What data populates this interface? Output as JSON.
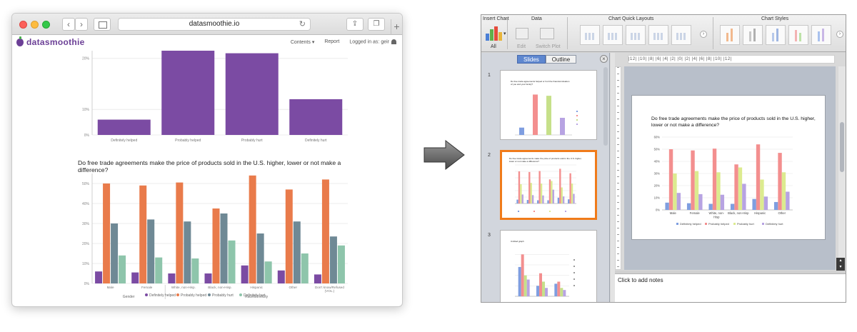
{
  "browser": {
    "url": "datasmoothie.io",
    "site_name": "datasmoothie",
    "nav": {
      "contents": "Contents",
      "report": "Report",
      "logged_in": "Logged in as: geir"
    },
    "top_chart": {
      "categories": [
        "Definitely helped",
        "Probably helped",
        "Probably hurt",
        "Definitely hurt"
      ],
      "values": [
        6,
        33,
        32,
        14
      ],
      "ticks": [
        "20%",
        "10%",
        "0%"
      ],
      "color": "#7b4ba3"
    },
    "main_chart": {
      "title_line1": "Do free trade agreements make the price of products sold in the U.S. higher, lower or not make a",
      "title_line2": "difference?",
      "categories": [
        "Male",
        "Female",
        "White, non-Hisp.",
        "Black, non-Hisp.",
        "Hispanic",
        "Other",
        "Don't know/Refused (VOL.)"
      ],
      "series": [
        {
          "name": "Definitely helped",
          "color": "#7b4ba3",
          "values": [
            6,
            5.5,
            5,
            5,
            9,
            6.5,
            4.5
          ]
        },
        {
          "name": "Probably helped",
          "color": "#e97b4b",
          "values": [
            50,
            49,
            50.5,
            37.5,
            54,
            47,
            52
          ]
        },
        {
          "name": "Probably hurt",
          "color": "#6f8995",
          "values": [
            30,
            32,
            31,
            35,
            25,
            31,
            23.5
          ]
        },
        {
          "name": "Definitely hurt",
          "color": "#8ec5ab",
          "values": [
            14,
            13,
            12.5,
            21.5,
            11,
            15,
            19
          ]
        }
      ],
      "ticks": [
        "50%",
        "40%",
        "30%",
        "20%",
        "10%",
        "0%"
      ],
      "groups": [
        "Gender",
        "Race/Ethnicity"
      ]
    }
  },
  "ppt": {
    "ribbon": {
      "insert_chart": "Insert Chart",
      "data": "Data",
      "quick_layouts": "Chart Quick Layouts",
      "styles": "Chart Styles",
      "all": "All",
      "edit": "Edit",
      "switch_plot": "Switch Plot"
    },
    "tabs": {
      "slides": "Slides",
      "outline": "Outline"
    },
    "slide_numbers": [
      "1",
      "2",
      "3"
    ],
    "ruler_text": "|12| |10| |8| |6| |4| |2| |0| |2| |4| |6| |8| |10| |12|",
    "thumb_titles": {
      "s1": "Do free trade agreements helped or hurt the financial situation of you and your family?",
      "s2": "Do free trade agreements make the price of products sold in the U.S. higher, lower or not make a difference?",
      "s3": "Untitled graph"
    },
    "slide": {
      "title_line1": "Do free trade agreements make the price of products sold in the U.S. higher,",
      "title_line2": "lower or not make a difference?",
      "categories": [
        "Male",
        "Female",
        "White, non-",
        "Black, non-Hisp",
        "Hispanic",
        "Other"
      ],
      "categories_line2": [
        "",
        "",
        "Hisp",
        "",
        "",
        ""
      ],
      "ticks": [
        "60%",
        "50%",
        "40%",
        "30%",
        "20%",
        "10%",
        "0%"
      ],
      "series": [
        {
          "name": "Definitely helped",
          "color": "#7f9ee0",
          "values": [
            6,
            5.5,
            5,
            5,
            9,
            6.5
          ]
        },
        {
          "name": "Probably helped",
          "color": "#f38f8f",
          "values": [
            50,
            49,
            50.5,
            37.5,
            54,
            47
          ]
        },
        {
          "name": "Probably hurt",
          "color": "#dceb8f",
          "values": [
            30,
            32,
            31,
            35,
            25,
            31
          ]
        },
        {
          "name": "Definitely hurt",
          "color": "#b7a3e2",
          "values": [
            14,
            13,
            12.5,
            21.5,
            11,
            15
          ]
        }
      ]
    },
    "notes_placeholder": "Click to add notes"
  },
  "chart_data": [
    {
      "type": "bar",
      "categories": [
        "Definitely helped",
        "Probably helped",
        "Probably hurt",
        "Definitely hurt"
      ],
      "values": [
        6,
        33,
        32,
        14
      ],
      "ylim": [
        0,
        33
      ]
    },
    {
      "type": "bar",
      "title": "Do free trade agreements make the price of products sold in the U.S. higher, lower or not make a difference?",
      "categories": [
        "Male",
        "Female",
        "White, non-Hisp.",
        "Black, non-Hisp.",
        "Hispanic",
        "Other",
        "Don't know/Refused (VOL.)"
      ],
      "series": [
        {
          "name": "Definitely helped",
          "values": [
            6,
            5.5,
            5,
            5,
            9,
            6.5,
            4.5
          ]
        },
        {
          "name": "Probably helped",
          "values": [
            50,
            49,
            50.5,
            37.5,
            54,
            47,
            52
          ]
        },
        {
          "name": "Probably hurt",
          "values": [
            30,
            32,
            31,
            35,
            25,
            31,
            23.5
          ]
        },
        {
          "name": "Definitely hurt",
          "values": [
            14,
            13,
            12.5,
            21.5,
            11,
            15,
            19
          ]
        }
      ],
      "ylim": [
        0,
        55
      ],
      "legend": "bottom"
    },
    {
      "type": "bar",
      "title": "Do free trade agreements make the price of products sold in the U.S. higher, lower or not make a difference?",
      "categories": [
        "Male",
        "Female",
        "White, non-Hisp",
        "Black, non-Hisp",
        "Hispanic",
        "Other"
      ],
      "series": [
        {
          "name": "Definitely helped",
          "values": [
            6,
            5.5,
            5,
            5,
            9,
            6.5
          ]
        },
        {
          "name": "Probably helped",
          "values": [
            50,
            49,
            50.5,
            37.5,
            54,
            47
          ]
        },
        {
          "name": "Probably hurt",
          "values": [
            30,
            32,
            31,
            35,
            25,
            31
          ]
        },
        {
          "name": "Definitely hurt",
          "values": [
            14,
            13,
            12.5,
            21.5,
            11,
            15
          ]
        }
      ],
      "ylim": [
        0,
        60
      ],
      "legend": "bottom"
    }
  ]
}
